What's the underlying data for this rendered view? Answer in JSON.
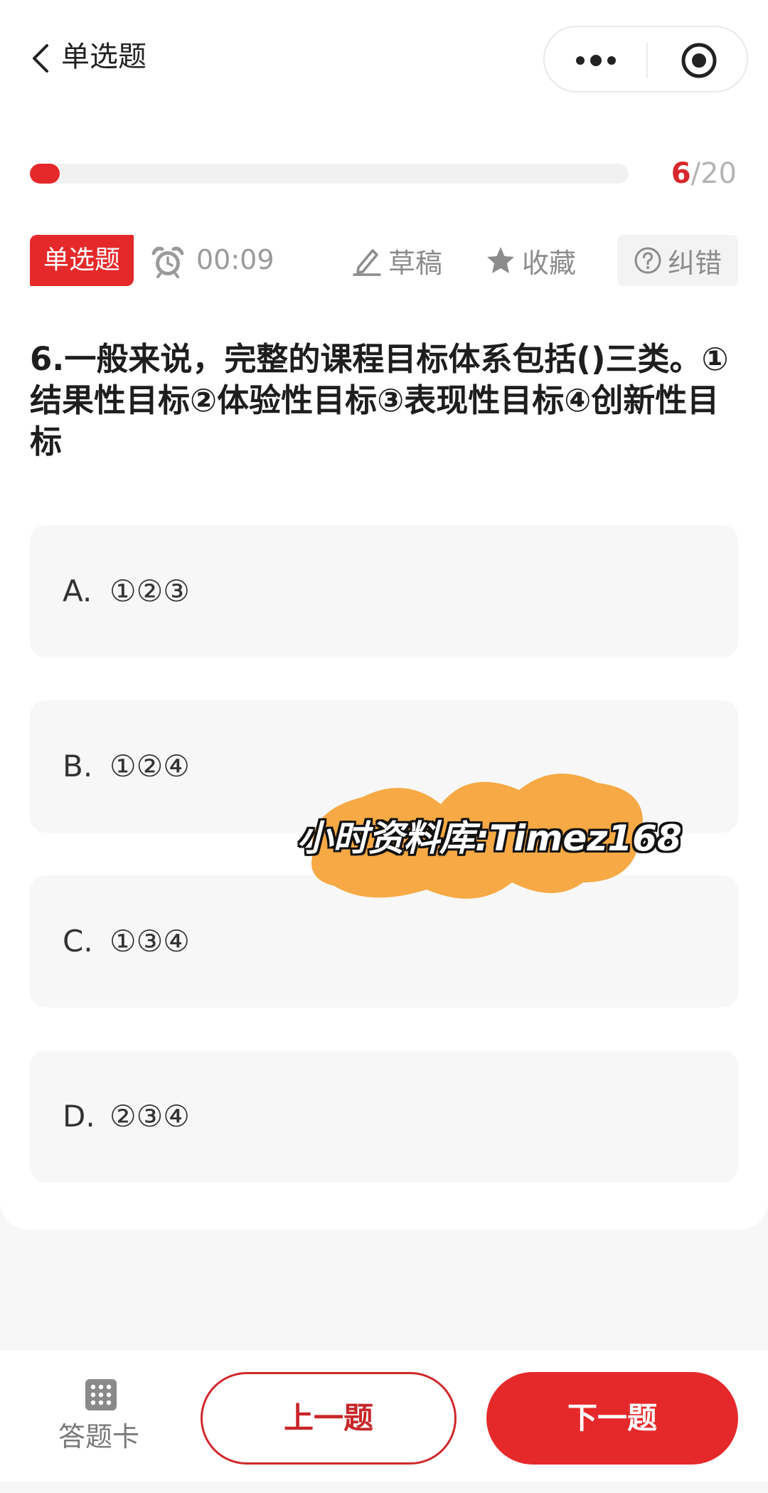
{
  "nav": {
    "title": "单选题"
  },
  "progress": {
    "current": "6",
    "total": "/20",
    "fraction": 0.05
  },
  "toolbar": {
    "type_badge": "单选题",
    "timer": "00:09",
    "draft_label": "草稿",
    "favorite_label": "收藏",
    "report_label": "纠错"
  },
  "question": {
    "text": "6.一般来说，完整的课程目标体系包括()三类。①结果性目标②体验性目标③表现性目标④创新性目标"
  },
  "options": [
    {
      "letter": "A.",
      "text": "①②③"
    },
    {
      "letter": "B.",
      "text": "①②④"
    },
    {
      "letter": "C.",
      "text": "①③④"
    },
    {
      "letter": "D.",
      "text": "②③④"
    }
  ],
  "watermark": {
    "text": "小时资料库:Timez168"
  },
  "bottom": {
    "answer_sheet_label": "答题卡",
    "prev_label": "上一题",
    "next_label": "下一题"
  },
  "colors": {
    "accent": "#e5292b",
    "option_bg": "#f7f7f7",
    "watermark_blob": "#f6a43a"
  }
}
